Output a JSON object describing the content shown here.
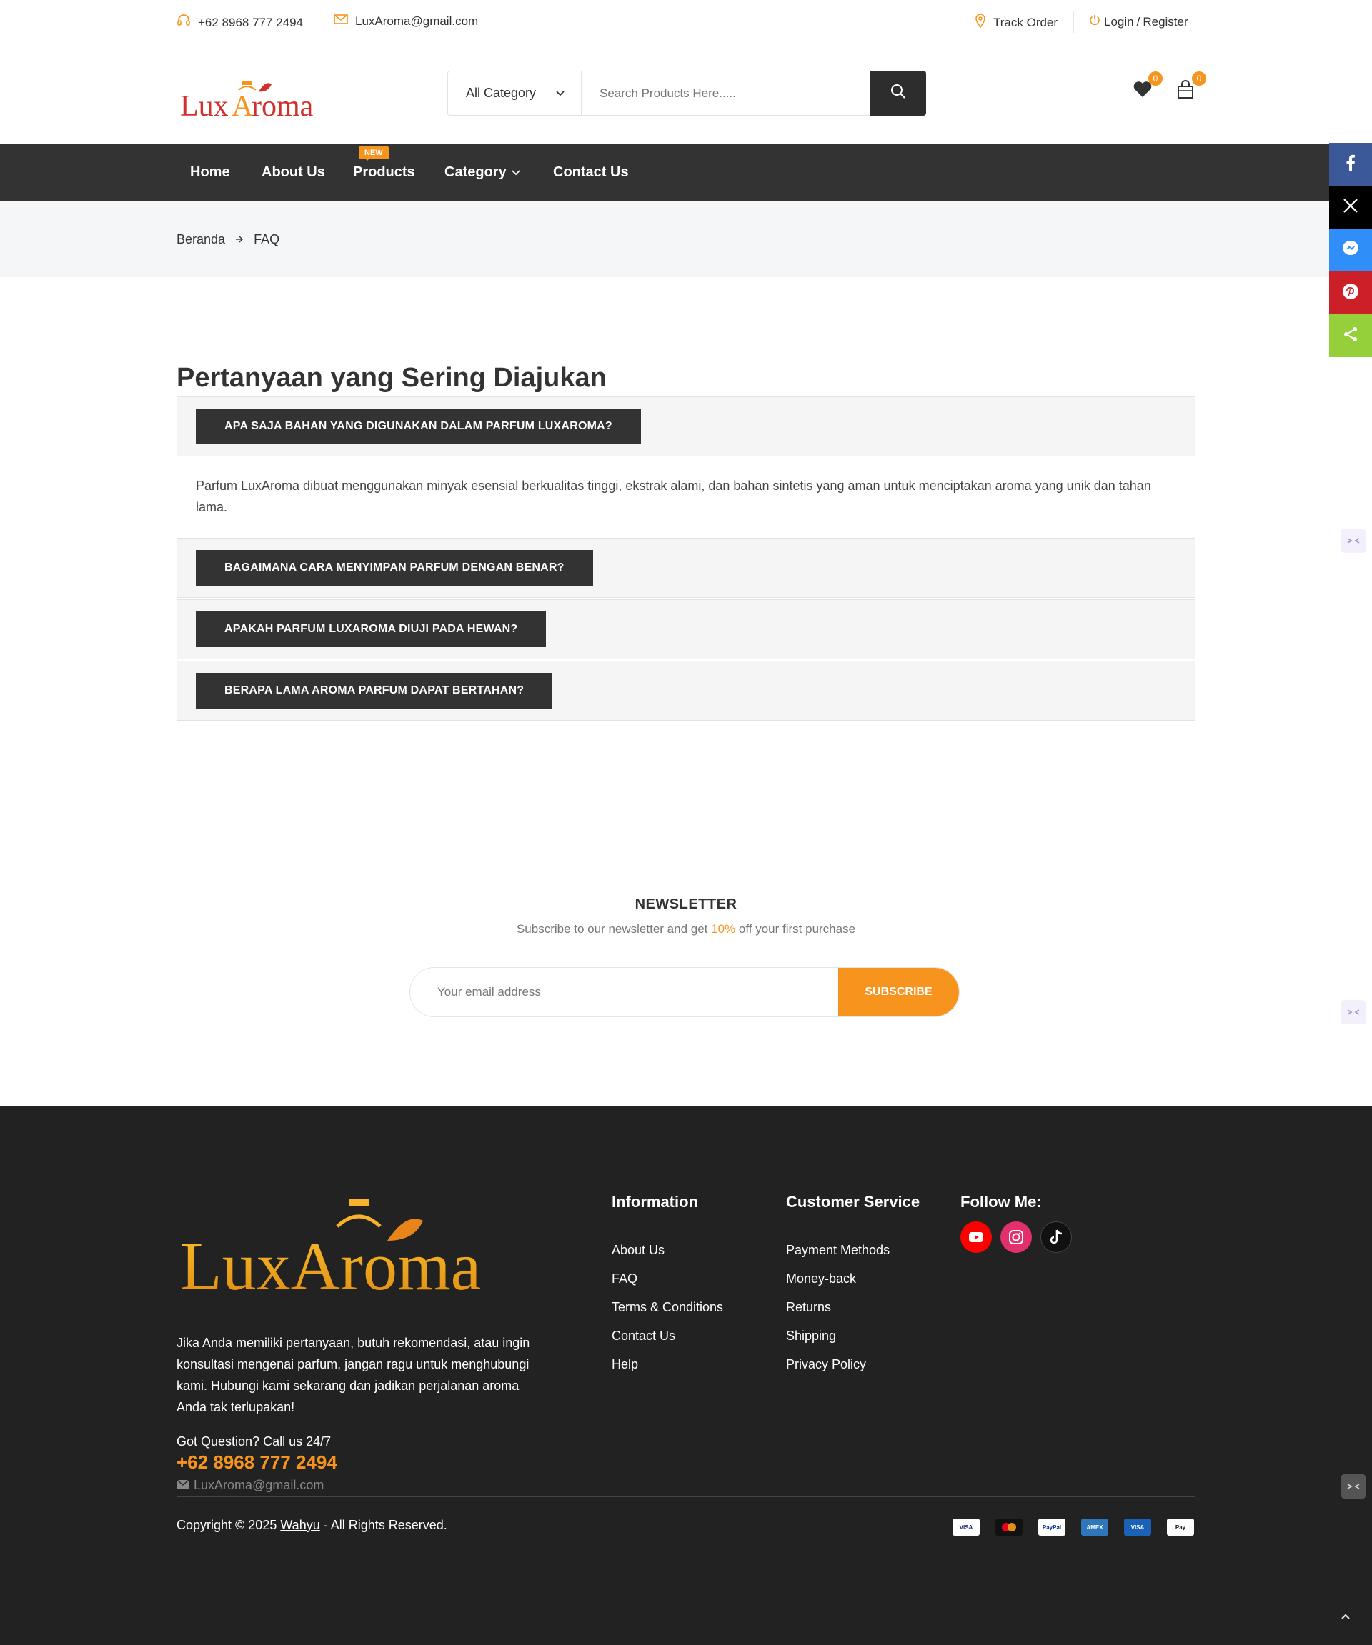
{
  "topbar": {
    "phone": "+62 8968 777 2494",
    "email": "LuxAroma@gmail.com",
    "track_order": "Track Order",
    "login": "Login",
    "slash": "/",
    "register": "Register"
  },
  "header": {
    "logo_text": "LuxAroma",
    "category_select": "All Category",
    "search_placeholder": "Search Products Here.....",
    "wishlist_count": "0",
    "cart_count": "0"
  },
  "nav": {
    "items": [
      {
        "label": "Home"
      },
      {
        "label": "About Us"
      },
      {
        "label": "Products",
        "tag": "NEW"
      },
      {
        "label": "Category"
      },
      {
        "label": "Contact Us"
      }
    ]
  },
  "breadcrumb": {
    "home": "Beranda",
    "current": "FAQ"
  },
  "faq": {
    "title": "Pertanyaan yang Sering Diajukan",
    "items": [
      {
        "question": "APA SAJA BAHAN YANG DIGUNAKAN DALAM PARFUM LUXAROMA?",
        "answer": "Parfum LuxAroma dibuat menggunakan minyak esensial berkualitas tinggi, ekstrak alami, dan bahan sintetis yang aman untuk menciptakan aroma yang unik dan tahan lama."
      },
      {
        "question": "BAGAIMANA CARA MENYIMPAN PARFUM DENGAN BENAR?"
      },
      {
        "question": "APAKAH PARFUM LUXAROMA DIUJI PADA HEWAN?"
      },
      {
        "question": "BERAPA LAMA AROMA PARFUM DAPAT BERTAHAN?"
      }
    ]
  },
  "newsletter": {
    "title": "NEWSLETTER",
    "sub_before": "Subscribe to our newsletter and get",
    "sub_highlight": "10%",
    "sub_after": "off your first purchase",
    "placeholder": "Your email address",
    "button": "SUBSCRIBE"
  },
  "footer": {
    "logo_text": "LuxAroma",
    "about": "Jika Anda memiliki pertanyaan, butuh rekomendasi, atau ingin konsultasi mengenai parfum, jangan ragu untuk menghubungi kami. Hubungi kami sekarang dan jadikan perjalanan aroma Anda tak terlupakan!",
    "question": "Got Question? Call us 24/7",
    "phone": "+62 8968 777 2494",
    "email": "LuxAroma@gmail.com",
    "information": {
      "title": "Information",
      "links": [
        "About Us",
        "FAQ",
        "Terms & Conditions",
        "Contact Us",
        "Help"
      ]
    },
    "customer_service": {
      "title": "Customer Service",
      "links": [
        "Payment Methods",
        "Money-back",
        "Returns",
        "Shipping",
        "Privacy Policy"
      ]
    },
    "follow": {
      "title": "Follow Me:",
      "icons": [
        "youtube-icon",
        "instagram-icon",
        "tiktok-icon"
      ]
    },
    "copyright_before": "Copyright © 2025",
    "copyright_link": "Wahyu",
    "copyright_after": "- All Rights Reserved.",
    "payments": [
      "VISA",
      "mastercard",
      "PayPal",
      "AMEX",
      "VISA",
      "Pay"
    ]
  },
  "colors": {
    "accent": "#f7941d",
    "dark": "#333333",
    "footer_bg": "#222222",
    "facebook": "#3b5998",
    "twitter": "#000000",
    "messenger": "#2f8ef7",
    "pinterest": "#cb2027",
    "share": "#95d03a"
  }
}
